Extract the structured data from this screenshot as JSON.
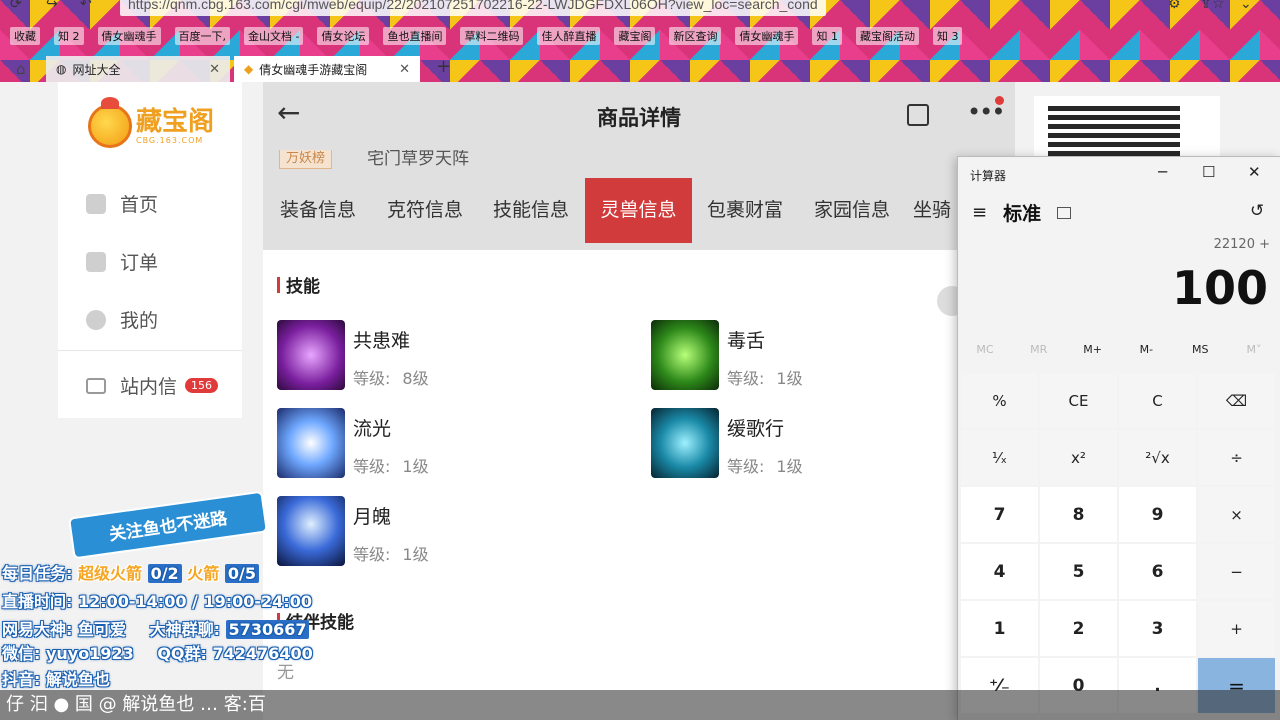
{
  "browser": {
    "url": "https://qnm.cbg.163.com/cgi/mweb/equip/22/202107251702216-22-LWJDGFDXL06OH?view_loc=search_cond",
    "bookmarks": [
      "收藏",
      "知 2",
      "倩女幽魂手",
      "百度一下,",
      "金山文档 -",
      "倩女论坛",
      "鱼也直播间",
      "草料二维码",
      "佳人醉直播",
      "藏宝阁",
      "新区查询",
      "倩女幽魂手",
      "知 1",
      "藏宝阁活动",
      "知 3"
    ],
    "tabs": [
      {
        "label": "网址大全"
      },
      {
        "label": "倩女幽魂手游藏宝阁"
      }
    ],
    "new_tab": "+"
  },
  "sidebar": {
    "logo_text": "藏宝阁",
    "logo_sub": "CBG.163.COM",
    "items": [
      {
        "label": "首页"
      },
      {
        "label": "订单"
      },
      {
        "label": "我的"
      },
      {
        "label": "站内信",
        "badge": "156"
      }
    ]
  },
  "phone": {
    "header_title": "商品详情",
    "peek_tag": "万妖榜",
    "peek_text": "宅门草罗天阵",
    "tabs": [
      "装备信息",
      "克符信息",
      "技能信息",
      "灵兽信息",
      "包裹财富",
      "家园信息",
      "坐骑"
    ],
    "active_tab": "灵兽信息",
    "section1": "技能",
    "skills": [
      {
        "name": "共患难",
        "level_label": "等级:",
        "level": "8级"
      },
      {
        "name": "毒舌",
        "level_label": "等级:",
        "level": "1级"
      },
      {
        "name": "流光",
        "level_label": "等级:",
        "level": "1级"
      },
      {
        "name": "缓歌行",
        "level_label": "等级:",
        "level": "1级"
      },
      {
        "name": "月魄",
        "level_label": "等级:",
        "level": "1级"
      }
    ],
    "section2": "结伴技能",
    "none_text": "无"
  },
  "calculator": {
    "window_title": "计算器",
    "mode": "标准",
    "expression": "22120 +",
    "display": "100",
    "memory": [
      "MC",
      "MR",
      "M+",
      "M-",
      "MS",
      "M˅"
    ],
    "keys": [
      "%",
      "CE",
      "C",
      "⌫",
      "¹⁄ₓ",
      "x²",
      "²√x",
      "÷",
      "7",
      "8",
      "9",
      "×",
      "4",
      "5",
      "6",
      "−",
      "1",
      "2",
      "3",
      "+",
      "⁺⁄₋",
      "0",
      ".",
      "="
    ]
  },
  "overlay": {
    "bubble": "关注鱼也不迷路",
    "task_label": "每日任务:",
    "task1": "超级火箭",
    "task1_count": "0/2",
    "task2": "火箭",
    "task2_count": "0/5",
    "live_time": "直播时间: 12:00-14:00 / 19:00-24:00",
    "netease": "网易大神: 鱼可爱",
    "group_label": "大神群聊:",
    "group": "5730667",
    "wechat": "微信: yuyo1923",
    "qq_label": "QQ群:",
    "qq": "742476400",
    "douyin": "抖音: 解说鱼也"
  },
  "ticker": "仔 汩 ● 国  @  解说鱼也 … 客:百"
}
